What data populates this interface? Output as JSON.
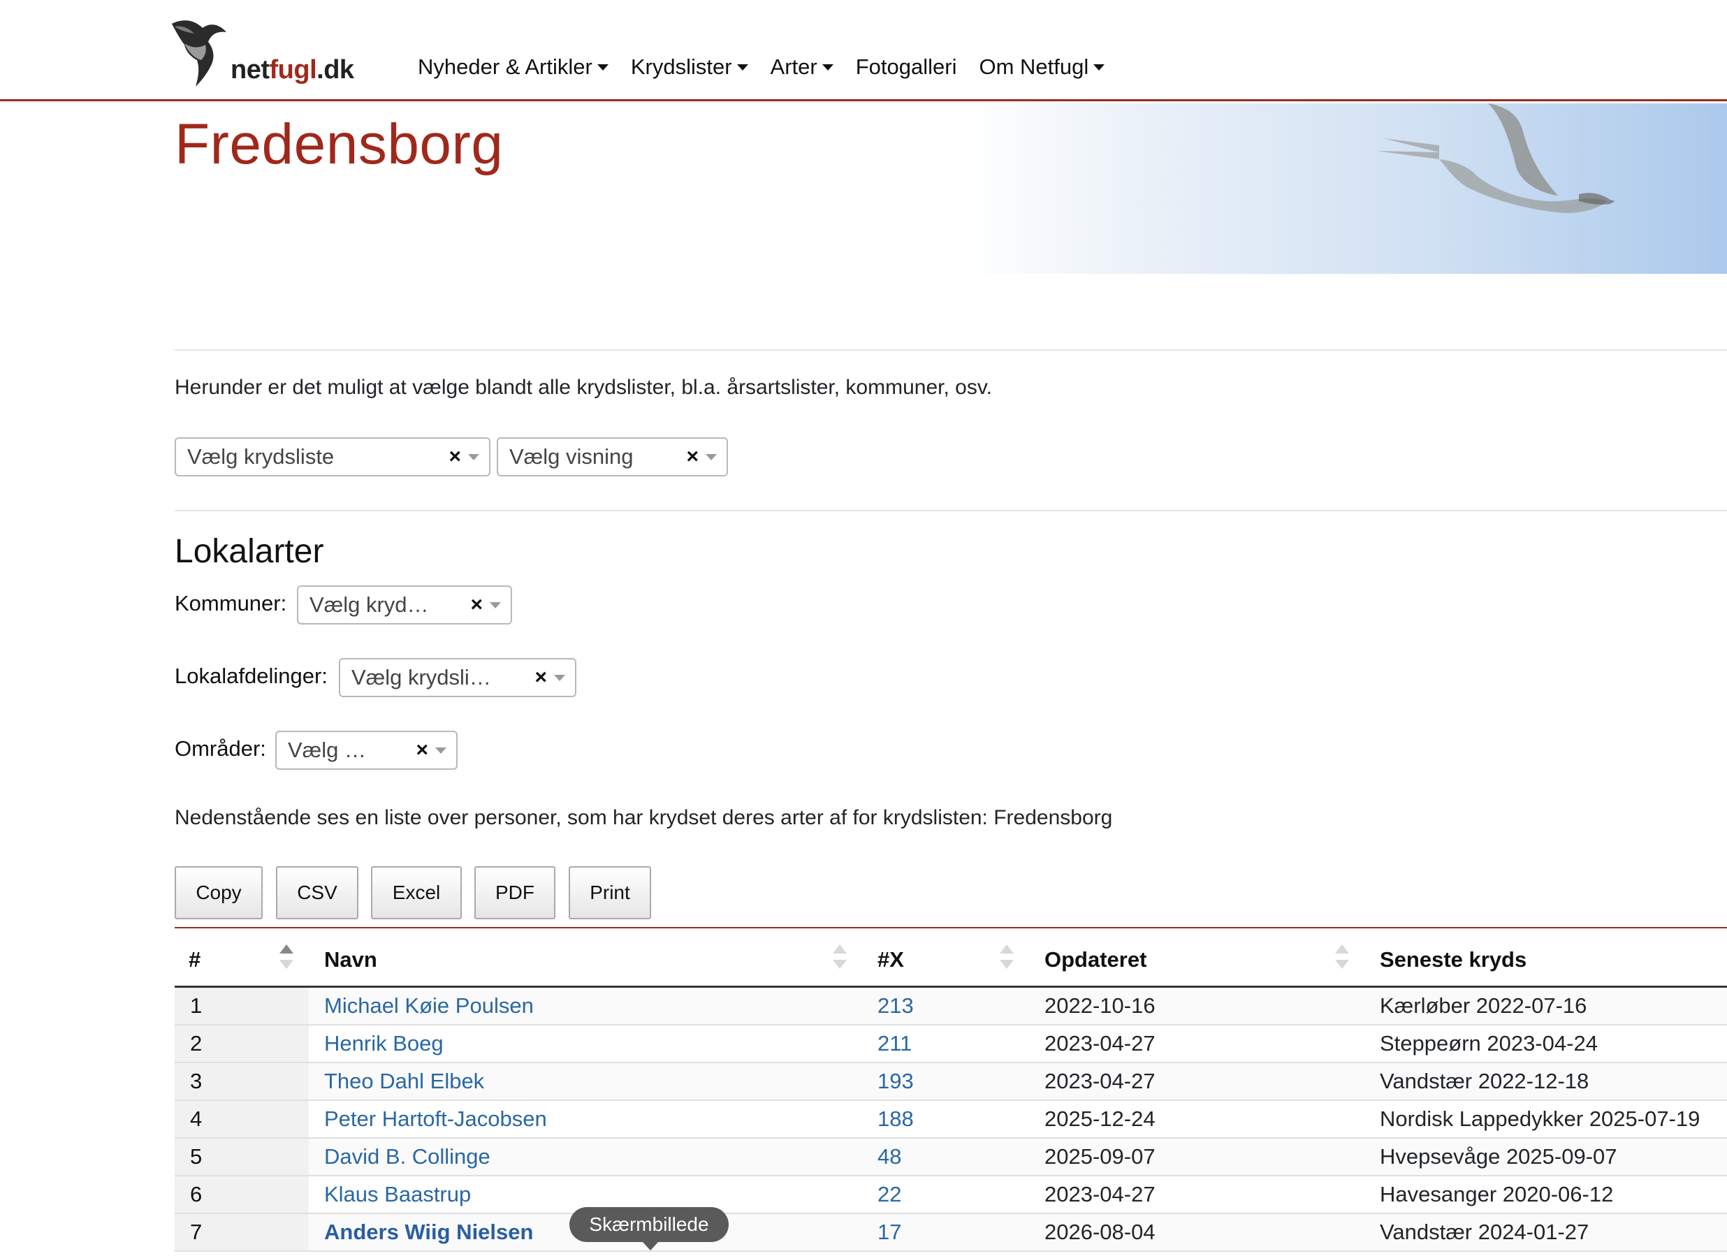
{
  "brand": {
    "logo_icon": "seagull-logo-icon",
    "name_part1": "net",
    "name_part2": "fugl",
    "name_part3": ".dk",
    "accent_color": "#a0281b"
  },
  "nav": {
    "items": [
      {
        "label": "Nyheder & Artikler",
        "dropdown": true
      },
      {
        "label": "Krydslister",
        "dropdown": true
      },
      {
        "label": "Arter",
        "dropdown": true
      },
      {
        "label": "Fotogalleri",
        "dropdown": false
      },
      {
        "label": "Om Netfugl",
        "dropdown": true
      }
    ]
  },
  "page": {
    "title": "Fredensborg",
    "intro": "Herunder er det muligt at vælge blandt alle krydslister, bl.a. årsartslister, kommuner, osv.",
    "select_list_placeholder": "Vælg krydsliste",
    "select_view_placeholder": "Vælg visning",
    "section_title": "Lokalarter",
    "filters": [
      {
        "label": "Kommuner:",
        "placeholder": "Vælg kryd…"
      },
      {
        "label": "Lokalafdelinger:",
        "placeholder": "Vælg krydsli…"
      },
      {
        "label": "Områder:",
        "placeholder": "Vælg …"
      }
    ],
    "description": "Nedenstående ses en liste over personer, som har krydset deres arter af for krydslisten: Fredensborg"
  },
  "buttons": [
    "Copy",
    "CSV",
    "Excel",
    "PDF",
    "Print"
  ],
  "table": {
    "columns": [
      "#",
      "Navn",
      "#X",
      "Opdateret",
      "Seneste kryds"
    ],
    "rows": [
      {
        "rank": "1",
        "name": "Michael Køie Poulsen",
        "count": "213",
        "updated": "2022-10-16",
        "latest": "Kærløber 2022-07-16"
      },
      {
        "rank": "2",
        "name": "Henrik Boeg",
        "count": "211",
        "updated": "2023-04-27",
        "latest": "Steppeørn 2023-04-24"
      },
      {
        "rank": "3",
        "name": "Theo Dahl Elbek",
        "count": "193",
        "updated": "2023-04-27",
        "latest": "Vandstær 2022-12-18"
      },
      {
        "rank": "4",
        "name": "Peter Hartoft-Jacobsen",
        "count": "188",
        "updated": "2025-12-24",
        "latest": "Nordisk Lappedykker 2025-07-19"
      },
      {
        "rank": "5",
        "name": "David B. Collinge",
        "count": "48",
        "updated": "2025-09-07",
        "latest": "Hvepsevåge 2025-09-07"
      },
      {
        "rank": "6",
        "name": "Klaus Baastrup",
        "count": "22",
        "updated": "2023-04-27",
        "latest": "Havesanger 2020-06-12"
      },
      {
        "rank": "7",
        "name": "Anders Wiig Nielsen",
        "count": "17",
        "updated": "2026-08-04",
        "latest": "Vandstær 2024-01-27"
      }
    ]
  },
  "tooltip": "Skærmbillede"
}
